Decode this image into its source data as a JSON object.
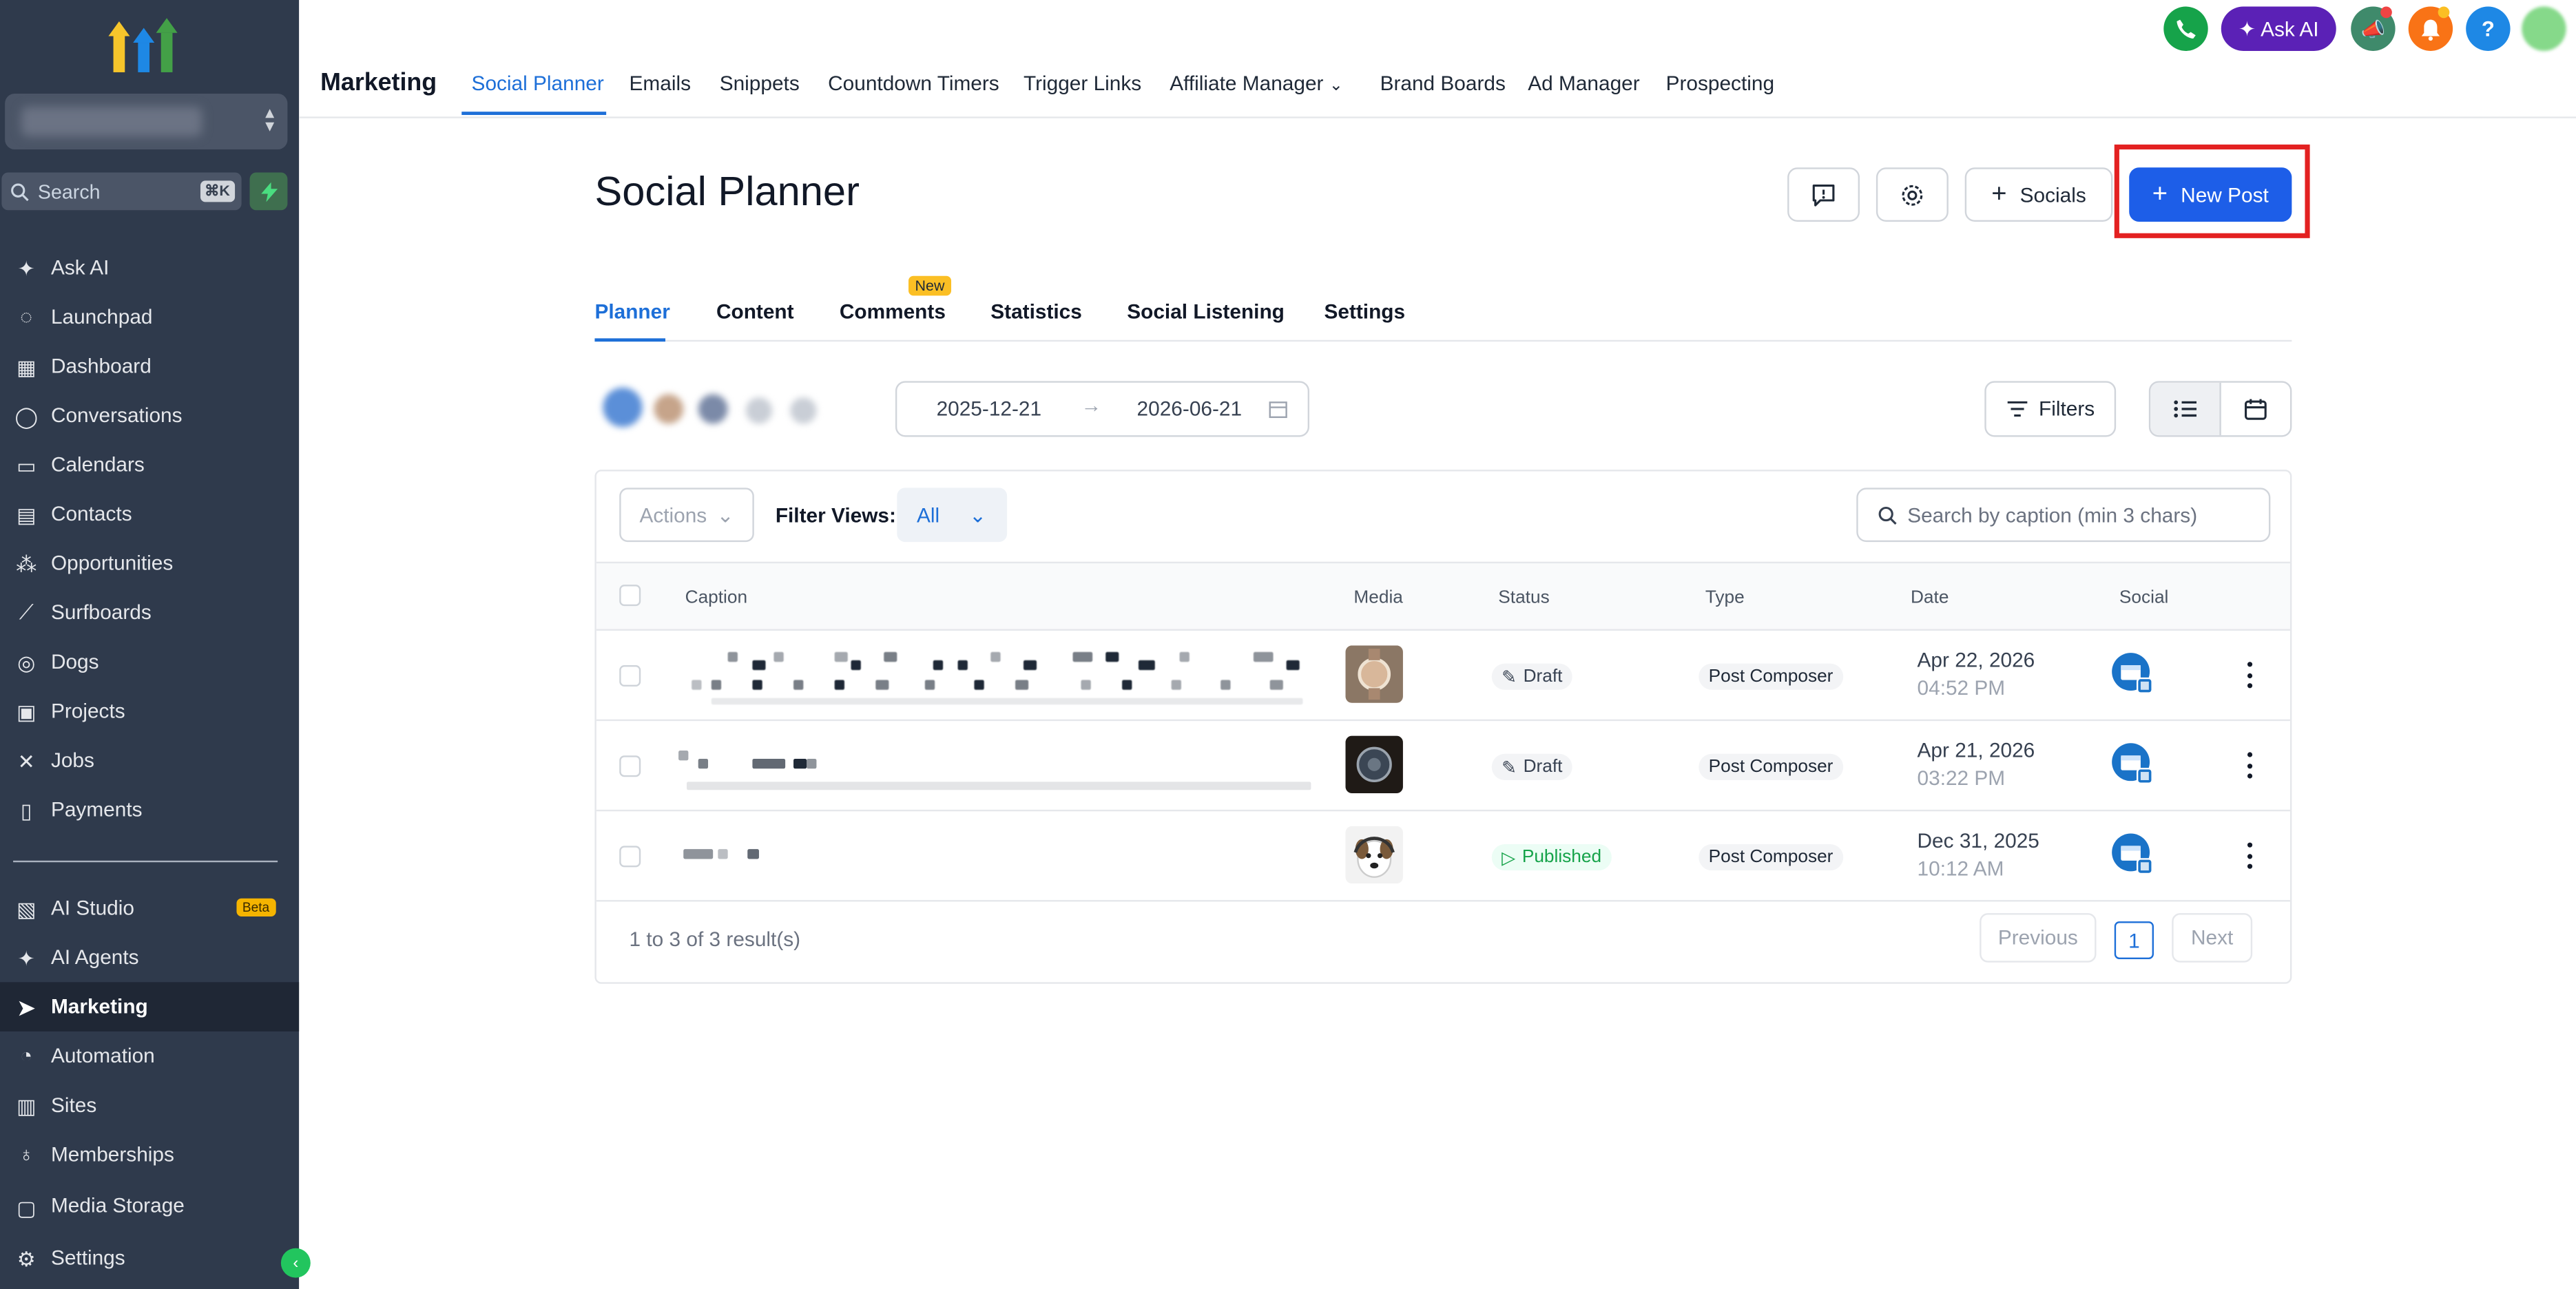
{
  "sidebar": {
    "search_placeholder": "Search",
    "search_shortcut": "⌘K",
    "items": [
      {
        "label": "Ask AI",
        "icon": "sparkle-icon"
      },
      {
        "label": "Launchpad",
        "icon": "rocket-icon"
      },
      {
        "label": "Dashboard",
        "icon": "dashboard-icon"
      },
      {
        "label": "Conversations",
        "icon": "chat-icon"
      },
      {
        "label": "Calendars",
        "icon": "calendar-icon"
      },
      {
        "label": "Contacts",
        "icon": "contacts-icon"
      },
      {
        "label": "Opportunities",
        "icon": "opportunities-icon"
      },
      {
        "label": "Surfboards",
        "icon": "surfboard-icon"
      },
      {
        "label": "Dogs",
        "icon": "dog-icon"
      },
      {
        "label": "Projects",
        "icon": "projects-icon"
      },
      {
        "label": "Jobs",
        "icon": "tools-icon"
      },
      {
        "label": "Payments",
        "icon": "receipt-icon"
      }
    ],
    "items2": [
      {
        "label": "AI Studio",
        "icon": "ai-studio-icon",
        "badge": "Beta"
      },
      {
        "label": "AI Agents",
        "icon": "sparkle-icon"
      },
      {
        "label": "Marketing",
        "icon": "send-icon"
      },
      {
        "label": "Automation",
        "icon": "automation-icon"
      },
      {
        "label": "Sites",
        "icon": "sites-icon"
      },
      {
        "label": "Memberships",
        "icon": "award-icon"
      },
      {
        "label": "Media Storage",
        "icon": "folder-icon"
      }
    ],
    "settings_label": "Settings"
  },
  "topnav": {
    "brand": "Marketing",
    "tabs": [
      "Social Planner",
      "Emails",
      "Snippets",
      "Countdown Timers",
      "Trigger Links",
      "Affiliate Manager",
      "Brand Boards",
      "Ad Manager",
      "Prospecting"
    ],
    "ask_ai": "Ask AI",
    "help": "?"
  },
  "page": {
    "title": "Social Planner",
    "socials_button": "Socials",
    "new_post_button": "New Post",
    "subtabs": [
      "Planner",
      "Content",
      "Comments",
      "Statistics",
      "Social Listening",
      "Settings"
    ],
    "new_badge": "New",
    "date_from": "2025-12-21",
    "date_to": "2026-06-21",
    "filters_button": "Filters"
  },
  "table": {
    "actions_label": "Actions",
    "filter_views_label": "Filter Views:",
    "filter_views_value": "All",
    "search_placeholder": "Search by caption (min 3 chars)",
    "headers": [
      "Caption",
      "Media",
      "Status",
      "Type",
      "Date",
      "Social"
    ],
    "rows": [
      {
        "status": "Draft",
        "type": "Post Composer",
        "date": "Apr 22, 2026",
        "time": "04:52 PM"
      },
      {
        "status": "Draft",
        "type": "Post Composer",
        "date": "Apr 21, 2026",
        "time": "03:22 PM"
      },
      {
        "status": "Published",
        "type": "Post Composer",
        "date": "Dec 31, 2025",
        "time": "10:12 AM"
      }
    ],
    "result_text": "1 to 3 of 3 result(s)",
    "prev": "Previous",
    "page": "1",
    "next": "Next"
  },
  "colors": {
    "accent": "#1d6fd8",
    "primary_button": "#1d5ee8",
    "sidebar": "#2f3a4c",
    "highlight": "#e32121"
  }
}
